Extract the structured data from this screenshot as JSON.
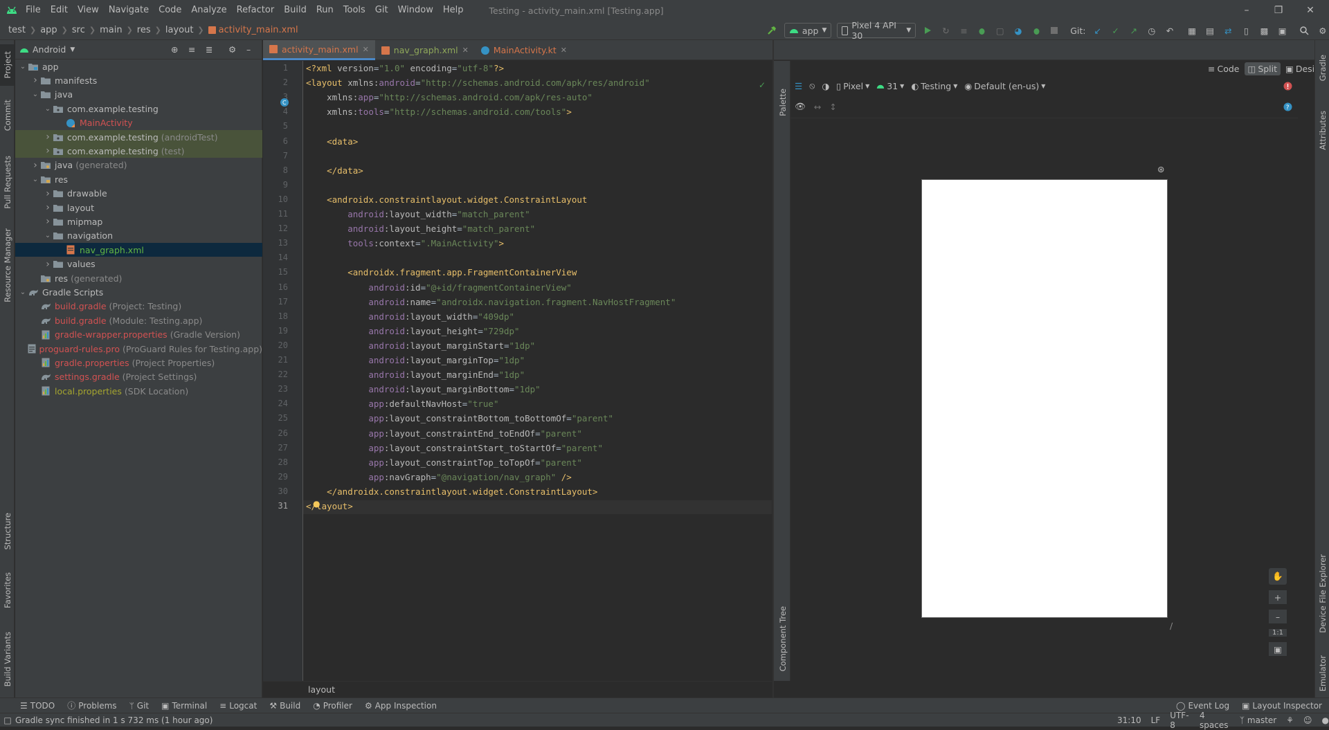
{
  "menu": [
    "File",
    "Edit",
    "View",
    "Navigate",
    "Code",
    "Analyze",
    "Refactor",
    "Build",
    "Run",
    "Tools",
    "Git",
    "Window",
    "Help"
  ],
  "window_title": "Testing - activity_main.xml [Testing.app]",
  "breadcrumbs": [
    "test",
    "app",
    "src",
    "main",
    "res",
    "layout",
    "activity_main.xml"
  ],
  "toolbar": {
    "run_config": "app",
    "device": "Pixel 4 API 30",
    "git_label": "Git:"
  },
  "project_panel": {
    "view_mode": "Android"
  },
  "tree": [
    {
      "label": "app",
      "suffix": "",
      "depth": 0,
      "arrow": "down",
      "icon": "folder-module",
      "color": "#bbbbbb"
    },
    {
      "label": "manifests",
      "suffix": "",
      "depth": 1,
      "arrow": "right",
      "icon": "folder",
      "color": "#bbbbbb"
    },
    {
      "label": "java",
      "suffix": "",
      "depth": 1,
      "arrow": "down",
      "icon": "folder",
      "color": "#bbbbbb"
    },
    {
      "label": "com.example.testing",
      "suffix": "",
      "depth": 2,
      "arrow": "down",
      "icon": "package",
      "color": "#bbbbbb"
    },
    {
      "label": "MainActivity",
      "suffix": "",
      "depth": 3,
      "arrow": "",
      "icon": "kotlin-class",
      "color": "#d25252"
    },
    {
      "label": "com.example.testing",
      "suffix": "(androidTest)",
      "depth": 2,
      "arrow": "right",
      "icon": "package",
      "color": "#bbbbbb",
      "highlight": "test"
    },
    {
      "label": "com.example.testing",
      "suffix": "(test)",
      "depth": 2,
      "arrow": "right",
      "icon": "package",
      "color": "#bbbbbb",
      "highlight": "test"
    },
    {
      "label": "java",
      "suffix": "(generated)",
      "depth": 1,
      "arrow": "right",
      "icon": "folder-gen",
      "color": "#bbbbbb"
    },
    {
      "label": "res",
      "suffix": "",
      "depth": 1,
      "arrow": "down",
      "icon": "folder-res",
      "color": "#bbbbbb"
    },
    {
      "label": "drawable",
      "suffix": "",
      "depth": 2,
      "arrow": "right",
      "icon": "folder",
      "color": "#bbbbbb"
    },
    {
      "label": "layout",
      "suffix": "",
      "depth": 2,
      "arrow": "right",
      "icon": "folder",
      "color": "#bbbbbb"
    },
    {
      "label": "mipmap",
      "suffix": "",
      "depth": 2,
      "arrow": "right",
      "icon": "folder",
      "color": "#bbbbbb"
    },
    {
      "label": "navigation",
      "suffix": "",
      "depth": 2,
      "arrow": "down",
      "icon": "folder",
      "color": "#bbbbbb"
    },
    {
      "label": "nav_graph.xml",
      "suffix": "",
      "depth": 3,
      "arrow": "",
      "icon": "xml",
      "color": "#62b543",
      "highlight": "selected"
    },
    {
      "label": "values",
      "suffix": "",
      "depth": 2,
      "arrow": "right",
      "icon": "folder",
      "color": "#bbbbbb"
    },
    {
      "label": "res",
      "suffix": "(generated)",
      "depth": 1,
      "arrow": "",
      "icon": "folder-gen",
      "color": "#bbbbbb"
    },
    {
      "label": "Gradle Scripts",
      "suffix": "",
      "depth": 0,
      "arrow": "down",
      "icon": "gradle",
      "color": "#bbbbbb"
    },
    {
      "label": "build.gradle",
      "suffix": "(Project: Testing)",
      "depth": 1,
      "arrow": "",
      "icon": "gradle",
      "color": "#d25252"
    },
    {
      "label": "build.gradle",
      "suffix": "(Module: Testing.app)",
      "depth": 1,
      "arrow": "",
      "icon": "gradle",
      "color": "#d25252"
    },
    {
      "label": "gradle-wrapper.properties",
      "suffix": "(Gradle Version)",
      "depth": 1,
      "arrow": "",
      "icon": "properties",
      "color": "#d25252"
    },
    {
      "label": "proguard-rules.pro",
      "suffix": "(ProGuard Rules for Testing.app)",
      "depth": 1,
      "arrow": "",
      "icon": "file",
      "color": "#d25252"
    },
    {
      "label": "gradle.properties",
      "suffix": "(Project Properties)",
      "depth": 1,
      "arrow": "",
      "icon": "properties",
      "color": "#d25252"
    },
    {
      "label": "settings.gradle",
      "suffix": "(Project Settings)",
      "depth": 1,
      "arrow": "",
      "icon": "gradle",
      "color": "#d25252"
    },
    {
      "label": "local.properties",
      "suffix": "(SDK Location)",
      "depth": 1,
      "arrow": "",
      "icon": "properties",
      "color": "#a5a52f"
    }
  ],
  "editor_tabs": [
    {
      "label": "activity_main.xml",
      "active": true,
      "icon": "xml-layout"
    },
    {
      "label": "nav_graph.xml",
      "active": false,
      "icon": "xml-nav"
    },
    {
      "label": "MainActivity.kt",
      "active": false,
      "icon": "kotlin"
    }
  ],
  "code_lines": [
    [
      {
        "t": "pi",
        "s": "<?xml "
      },
      {
        "t": "attr",
        "s": "version"
      },
      {
        "t": "plain",
        "s": "="
      },
      {
        "t": "val",
        "s": "\"1.0\""
      },
      {
        "t": "plain",
        "s": " "
      },
      {
        "t": "attr",
        "s": "encoding"
      },
      {
        "t": "plain",
        "s": "="
      },
      {
        "t": "val",
        "s": "\"utf-8\""
      },
      {
        "t": "pi",
        "s": "?>"
      }
    ],
    [
      {
        "t": "tag",
        "s": "<layout"
      },
      {
        "t": "plain",
        "s": " "
      },
      {
        "t": "attr",
        "s": "xmlns:"
      },
      {
        "t": "ns",
        "s": "android"
      },
      {
        "t": "plain",
        "s": "="
      },
      {
        "t": "val",
        "s": "\"http://schemas.android.com/apk/res/android\""
      }
    ],
    [
      {
        "t": "plain",
        "s": "    "
      },
      {
        "t": "attr",
        "s": "xmlns:"
      },
      {
        "t": "ns",
        "s": "app"
      },
      {
        "t": "plain",
        "s": "="
      },
      {
        "t": "val",
        "s": "\"http://schemas.android.com/apk/res-auto\""
      }
    ],
    [
      {
        "t": "plain",
        "s": "    "
      },
      {
        "t": "attr",
        "s": "xmlns:"
      },
      {
        "t": "ns",
        "s": "tools"
      },
      {
        "t": "plain",
        "s": "="
      },
      {
        "t": "val",
        "s": "\"http://schemas.android.com/tools\""
      },
      {
        "t": "tag",
        "s": ">"
      }
    ],
    [],
    [
      {
        "t": "plain",
        "s": "    "
      },
      {
        "t": "tag",
        "s": "<data>"
      }
    ],
    [],
    [
      {
        "t": "plain",
        "s": "    "
      },
      {
        "t": "tag",
        "s": "</data>"
      }
    ],
    [],
    [
      {
        "t": "plain",
        "s": "    "
      },
      {
        "t": "tag",
        "s": "<androidx.constraintlayout.widget.ConstraintLayout"
      }
    ],
    [
      {
        "t": "plain",
        "s": "        "
      },
      {
        "t": "ns",
        "s": "android"
      },
      {
        "t": "attr",
        "s": ":layout_width"
      },
      {
        "t": "plain",
        "s": "="
      },
      {
        "t": "val",
        "s": "\"match_parent\""
      }
    ],
    [
      {
        "t": "plain",
        "s": "        "
      },
      {
        "t": "ns",
        "s": "android"
      },
      {
        "t": "attr",
        "s": ":layout_height"
      },
      {
        "t": "plain",
        "s": "="
      },
      {
        "t": "val",
        "s": "\"match_parent\""
      }
    ],
    [
      {
        "t": "plain",
        "s": "        "
      },
      {
        "t": "ns",
        "s": "tools"
      },
      {
        "t": "attr",
        "s": ":context"
      },
      {
        "t": "plain",
        "s": "="
      },
      {
        "t": "val",
        "s": "\".MainActivity\""
      },
      {
        "t": "tag",
        "s": ">"
      }
    ],
    [],
    [
      {
        "t": "plain",
        "s": "        "
      },
      {
        "t": "tag",
        "s": "<androidx.fragment.app.FragmentContainerView"
      }
    ],
    [
      {
        "t": "plain",
        "s": "            "
      },
      {
        "t": "ns",
        "s": "android"
      },
      {
        "t": "attr",
        "s": ":id"
      },
      {
        "t": "plain",
        "s": "="
      },
      {
        "t": "val",
        "s": "\"@+id/fragmentContainerView\""
      }
    ],
    [
      {
        "t": "plain",
        "s": "            "
      },
      {
        "t": "ns",
        "s": "android"
      },
      {
        "t": "attr",
        "s": ":name"
      },
      {
        "t": "plain",
        "s": "="
      },
      {
        "t": "val",
        "s": "\"androidx.navigation.fragment.NavHostFragment\""
      }
    ],
    [
      {
        "t": "plain",
        "s": "            "
      },
      {
        "t": "ns",
        "s": "android"
      },
      {
        "t": "attr",
        "s": ":layout_width"
      },
      {
        "t": "plain",
        "s": "="
      },
      {
        "t": "val",
        "s": "\"409dp\""
      }
    ],
    [
      {
        "t": "plain",
        "s": "            "
      },
      {
        "t": "ns",
        "s": "android"
      },
      {
        "t": "attr",
        "s": ":layout_height"
      },
      {
        "t": "plain",
        "s": "="
      },
      {
        "t": "val",
        "s": "\"729dp\""
      }
    ],
    [
      {
        "t": "plain",
        "s": "            "
      },
      {
        "t": "ns",
        "s": "android"
      },
      {
        "t": "attr",
        "s": ":layout_marginStart"
      },
      {
        "t": "plain",
        "s": "="
      },
      {
        "t": "val",
        "s": "\"1dp\""
      }
    ],
    [
      {
        "t": "plain",
        "s": "            "
      },
      {
        "t": "ns",
        "s": "android"
      },
      {
        "t": "attr",
        "s": ":layout_marginTop"
      },
      {
        "t": "plain",
        "s": "="
      },
      {
        "t": "val",
        "s": "\"1dp\""
      }
    ],
    [
      {
        "t": "plain",
        "s": "            "
      },
      {
        "t": "ns",
        "s": "android"
      },
      {
        "t": "attr",
        "s": ":layout_marginEnd"
      },
      {
        "t": "plain",
        "s": "="
      },
      {
        "t": "val",
        "s": "\"1dp\""
      }
    ],
    [
      {
        "t": "plain",
        "s": "            "
      },
      {
        "t": "ns",
        "s": "android"
      },
      {
        "t": "attr",
        "s": ":layout_marginBottom"
      },
      {
        "t": "plain",
        "s": "="
      },
      {
        "t": "val",
        "s": "\"1dp\""
      }
    ],
    [
      {
        "t": "plain",
        "s": "            "
      },
      {
        "t": "ns",
        "s": "app"
      },
      {
        "t": "attr",
        "s": ":defaultNavHost"
      },
      {
        "t": "plain",
        "s": "="
      },
      {
        "t": "val",
        "s": "\"true\""
      }
    ],
    [
      {
        "t": "plain",
        "s": "            "
      },
      {
        "t": "ns",
        "s": "app"
      },
      {
        "t": "attr",
        "s": ":layout_constraintBottom_toBottomOf"
      },
      {
        "t": "plain",
        "s": "="
      },
      {
        "t": "val",
        "s": "\"parent\""
      }
    ],
    [
      {
        "t": "plain",
        "s": "            "
      },
      {
        "t": "ns",
        "s": "app"
      },
      {
        "t": "attr",
        "s": ":layout_constraintEnd_toEndOf"
      },
      {
        "t": "plain",
        "s": "="
      },
      {
        "t": "val",
        "s": "\"parent\""
      }
    ],
    [
      {
        "t": "plain",
        "s": "            "
      },
      {
        "t": "ns",
        "s": "app"
      },
      {
        "t": "attr",
        "s": ":layout_constraintStart_toStartOf"
      },
      {
        "t": "plain",
        "s": "="
      },
      {
        "t": "val",
        "s": "\"parent\""
      }
    ],
    [
      {
        "t": "plain",
        "s": "            "
      },
      {
        "t": "ns",
        "s": "app"
      },
      {
        "t": "attr",
        "s": ":layout_constraintTop_toTopOf"
      },
      {
        "t": "plain",
        "s": "="
      },
      {
        "t": "val",
        "s": "\"parent\""
      }
    ],
    [
      {
        "t": "plain",
        "s": "            "
      },
      {
        "t": "ns",
        "s": "app"
      },
      {
        "t": "attr",
        "s": ":navGraph"
      },
      {
        "t": "plain",
        "s": "="
      },
      {
        "t": "val",
        "s": "\"@navigation/nav_graph\""
      },
      {
        "t": "plain",
        "s": " "
      },
      {
        "t": "tag",
        "s": "/>"
      }
    ],
    [
      {
        "t": "plain",
        "s": "    "
      },
      {
        "t": "tag",
        "s": "</androidx.constraintlayout.widget.ConstraintLayout>"
      }
    ],
    [
      {
        "t": "tag",
        "s": "</layout>"
      }
    ]
  ],
  "editor_breadcrumb": "layout",
  "view_modes": [
    "Code",
    "Split",
    "Design"
  ],
  "design_toolbar": {
    "device": "Pixel",
    "api": "31",
    "theme": "Testing",
    "locale": "Default (en-us)"
  },
  "zoom_controls": {
    "one_to_one": "1:1"
  },
  "side_tabs_left": [
    "Project",
    "Commit",
    "Pull Requests",
    "Resource Manager",
    "Structure",
    "Favorites",
    "Build Variants"
  ],
  "side_tabs_right": [
    "Gradle",
    "Attributes",
    "Device File Explorer",
    "Emulator"
  ],
  "palette_tabs": [
    "Palette",
    "Component Tree"
  ],
  "bottom_tools": [
    "TODO",
    "Problems",
    "Git",
    "Terminal",
    "Logcat",
    "Build",
    "Profiler",
    "App Inspection"
  ],
  "bottom_right_tools": [
    "Event Log",
    "Layout Inspector"
  ],
  "status": {
    "message": "Gradle sync finished in 1 s 732 ms (1 hour ago)",
    "position": "31:10",
    "line_sep": "LF",
    "encoding": "UTF-8",
    "indent": "4 spaces",
    "branch": "master"
  },
  "colors": {
    "accent": "#4a88c7",
    "android_green": "#3ddc84",
    "error": "#d25252"
  }
}
